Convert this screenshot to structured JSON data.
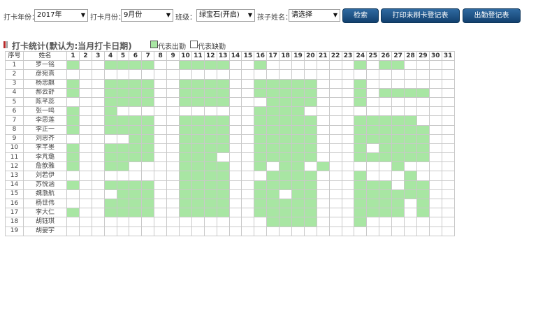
{
  "toolbar": {
    "year_label": "打卡年份：",
    "year_value": "2017年",
    "month_label": "打卡月份：",
    "month_value": "9月份",
    "class_label": "班级：",
    "class_value": "绿宝石(开启)",
    "child_label": "孩子姓名：",
    "child_value": "请选择",
    "search_button": "检索",
    "print_unswiped_button": "打印未刷卡登记表",
    "attendance_button": "出勤登记表"
  },
  "section": {
    "title": "打卡统计(默认为:当月打卡日期)",
    "legend_present": "代表出勤",
    "legend_absent": "代表缺勤",
    "present_color": "#a8e6a3"
  },
  "table": {
    "header_no": "序号",
    "header_name": "姓名",
    "days": [
      "1",
      "2",
      "3",
      "4",
      "5",
      "6",
      "7",
      "8",
      "9",
      "10",
      "11",
      "12",
      "13",
      "14",
      "15",
      "16",
      "17",
      "18",
      "19",
      "20",
      "21",
      "22",
      "23",
      "24",
      "25",
      "26",
      "27",
      "28",
      "29",
      "30",
      "31"
    ],
    "rows": [
      {
        "no": "1",
        "name": "罗一铭",
        "att": "1001111001111001000000010110000"
      },
      {
        "no": "2",
        "name": "彦宛熹",
        "att": "0000000000000000000000000000000"
      },
      {
        "no": "3",
        "name": "杨忠麒",
        "att": "1001111001111001111100010000000"
      },
      {
        "no": "4",
        "name": "郝云舒",
        "att": "1001111001111001111100010111100"
      },
      {
        "no": "5",
        "name": "陈芊蕊",
        "att": "0001111001111000111100010000000"
      },
      {
        "no": "6",
        "name": "张一鸣",
        "att": "1001000000000001111000000000000"
      },
      {
        "no": "7",
        "name": "李思莲",
        "att": "1001111001111001111100011111000"
      },
      {
        "no": "8",
        "name": "李正一",
        "att": "1001111001111001111100011111100"
      },
      {
        "no": "9",
        "name": "刘思齐",
        "att": "0000011001111001111100011111100"
      },
      {
        "no": "10",
        "name": "李芊墨",
        "att": "1001111001111001111100010111100"
      },
      {
        "no": "11",
        "name": "李芃璐",
        "att": "1001111001110001111100011111100"
      },
      {
        "no": "12",
        "name": "詹歆雅",
        "att": "1001100001111001011010000010000"
      },
      {
        "no": "13",
        "name": "刘若伊",
        "att": "0000000001111000111100010001000"
      },
      {
        "no": "14",
        "name": "苏悦涵",
        "att": "1001111001111001111100011101100"
      },
      {
        "no": "15",
        "name": "魏渤航",
        "att": "0000111001111001101100011111100"
      },
      {
        "no": "16",
        "name": "杨世伟",
        "att": "0001111001111001111100011110100"
      },
      {
        "no": "17",
        "name": "李大仁",
        "att": "1001111001111001111100011110100"
      },
      {
        "no": "18",
        "name": "胡钰琪",
        "att": "0000000000000000111100010000000"
      },
      {
        "no": "19",
        "name": "胡晏宇",
        "att": "0000000000000000000000000000000"
      }
    ]
  }
}
